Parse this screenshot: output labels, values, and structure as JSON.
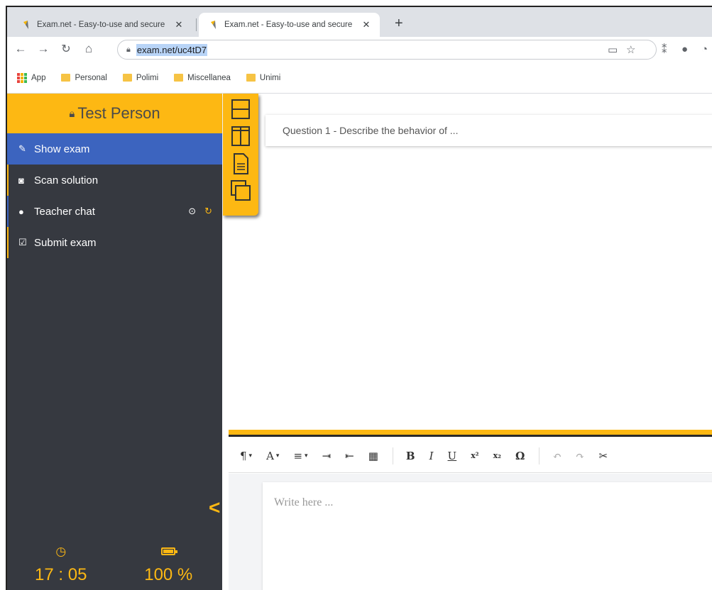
{
  "browser": {
    "tabs": [
      {
        "title": "Exam.net - Easy-to-use and secure",
        "active": false
      },
      {
        "title": "Exam.net - Easy-to-use and secure",
        "active": true
      }
    ],
    "url": "exam.net/uc4tD7",
    "bookmarks": [
      {
        "label": "App",
        "icon": "apps-grid-icon"
      },
      {
        "label": "Personal",
        "icon": "folder-icon"
      },
      {
        "label": "Polimi",
        "icon": "folder-icon"
      },
      {
        "label": "Miscellanea",
        "icon": "folder-icon"
      },
      {
        "label": "Unimi",
        "icon": "folder-icon"
      }
    ]
  },
  "sidebar": {
    "user": "Test Person",
    "items": [
      {
        "label": "Show exam",
        "icon": "edit-icon"
      },
      {
        "label": "Scan solution",
        "icon": "camera-icon"
      },
      {
        "label": "Teacher chat",
        "icon": "chat-icon"
      },
      {
        "label": "Submit exam",
        "icon": "check-square-icon"
      }
    ],
    "time": "17 : 05",
    "battery": "100 %"
  },
  "main": {
    "question": "Question 1 - Describe the behavior of ...",
    "editor_placeholder": "Write here ..."
  },
  "colors": {
    "accent": "#fdb813",
    "sidebar_bg": "#363940",
    "active_item": "#3c64bf"
  }
}
